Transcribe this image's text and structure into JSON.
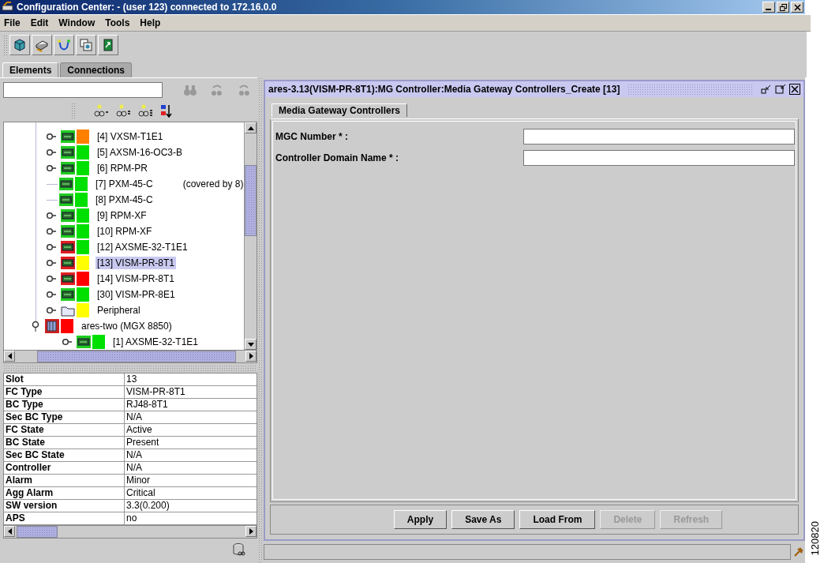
{
  "window": {
    "title": "Configuration Center: - (user 123) connected to 172.16.0.0"
  },
  "menu": [
    "File",
    "Edit",
    "Window",
    "Tools",
    "Help"
  ],
  "tabs": [
    {
      "label": "Elements",
      "selected": true
    },
    {
      "label": "Connections",
      "selected": false
    }
  ],
  "tree": {
    "items": [
      {
        "kind": "card",
        "label": "[4] VXSM-T1E1",
        "expandable": true,
        "card_alarm": false,
        "color": "#ff8000",
        "selected": false
      },
      {
        "kind": "card",
        "label": "[5] AXSM-16-OC3-B",
        "expandable": true,
        "card_alarm": false,
        "color": "#00e000",
        "selected": false
      },
      {
        "kind": "card",
        "label": "[6] RPM-PR",
        "expandable": true,
        "card_alarm": false,
        "color": "#00e000",
        "selected": false
      },
      {
        "kind": "card",
        "label": "[7] PXM-45-C",
        "note": "(covered by 8)",
        "expandable": false,
        "card_alarm": false,
        "color": "#00e000",
        "selected": false
      },
      {
        "kind": "card",
        "label": "[8] PXM-45-C",
        "expandable": false,
        "card_alarm": false,
        "color": "#00e000",
        "selected": false
      },
      {
        "kind": "card",
        "label": "[9] RPM-XF",
        "expandable": true,
        "card_alarm": false,
        "color": "#00e000",
        "selected": false
      },
      {
        "kind": "card",
        "label": "[10] RPM-XF",
        "expandable": true,
        "card_alarm": false,
        "color": "#00e000",
        "selected": false
      },
      {
        "kind": "card",
        "label": "[12] AXSME-32-T1E1",
        "expandable": true,
        "card_alarm": true,
        "color": "#00e000",
        "selected": false
      },
      {
        "kind": "card",
        "label": "[13] VISM-PR-8T1",
        "expandable": true,
        "card_alarm": true,
        "color": "#ffff00",
        "selected": true
      },
      {
        "kind": "card",
        "label": "[14] VISM-PR-8T1",
        "expandable": true,
        "card_alarm": true,
        "color": "#ff0000",
        "selected": false
      },
      {
        "kind": "card",
        "label": "[30] VISM-PR-8E1",
        "expandable": true,
        "card_alarm": false,
        "color": "#00e000",
        "selected": false
      },
      {
        "kind": "folder",
        "label": "Peripheral",
        "expandable": true,
        "color": "#ffff00",
        "selected": false
      },
      {
        "kind": "shelf",
        "label": "ares-two (MGX 8850)",
        "expanded": true,
        "color": "#ff0000",
        "selected": false,
        "children": [
          {
            "kind": "card",
            "label": "[1] AXSME-32-T1E1",
            "expandable": true,
            "card_alarm": false,
            "color": "#00e000",
            "selected": false
          }
        ]
      }
    ]
  },
  "properties": [
    {
      "name": "Slot",
      "value": "13"
    },
    {
      "name": "FC Type",
      "value": "VISM-PR-8T1"
    },
    {
      "name": "BC Type",
      "value": "RJ48-8T1"
    },
    {
      "name": "Sec BC Type",
      "value": "N/A"
    },
    {
      "name": "FC State",
      "value": "Active"
    },
    {
      "name": "BC State",
      "value": "Present"
    },
    {
      "name": "Sec BC State",
      "value": "N/A"
    },
    {
      "name": "Controller",
      "value": "N/A"
    },
    {
      "name": "Alarm",
      "value": "Minor"
    },
    {
      "name": "Agg Alarm",
      "value": "Critical"
    },
    {
      "name": "SW version",
      "value": "3.3(0.200)"
    },
    {
      "name": "APS",
      "value": "no"
    }
  ],
  "dialog": {
    "title": "ares-3.13(VISM-PR-8T1):MG Controller:Media Gateway Controllers_Create [13]",
    "tabs": [
      {
        "label": "Media Gateway Controllers",
        "selected": true
      }
    ],
    "fields": [
      {
        "label": "MGC Number * :"
      },
      {
        "label": "Controller Domain Name * :"
      }
    ],
    "buttons": [
      {
        "label": "Apply",
        "disabled": false
      },
      {
        "label": "Save As",
        "disabled": false
      },
      {
        "label": "Load From",
        "disabled": false
      },
      {
        "label": "Delete",
        "disabled": true
      },
      {
        "label": "Refresh",
        "disabled": true
      }
    ]
  },
  "figure_id": "120820"
}
